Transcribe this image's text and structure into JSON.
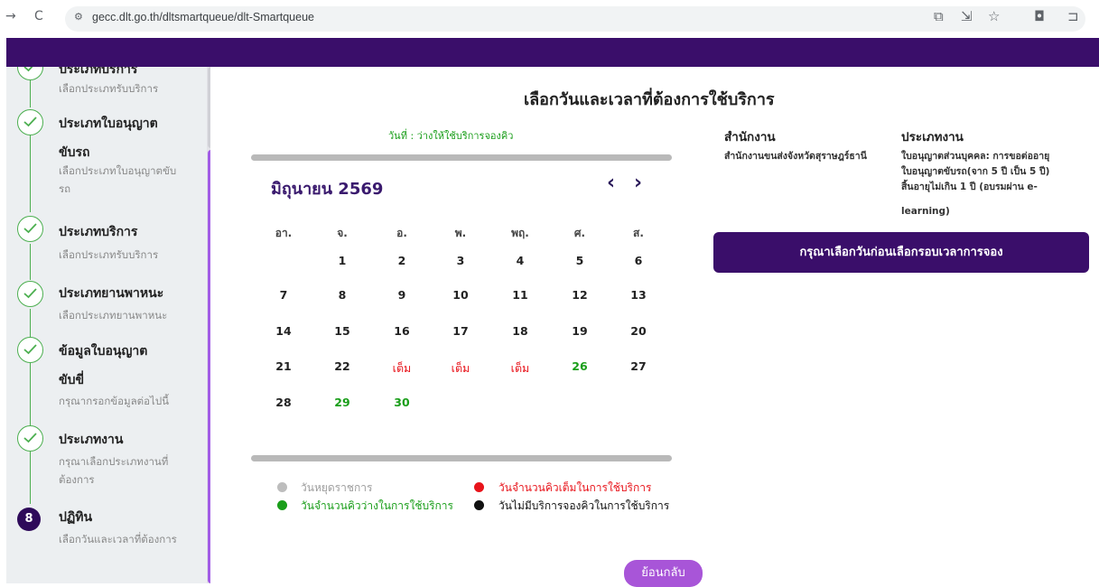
{
  "browser": {
    "url": "gecc.dlt.go.th/dltsmartqueue/dlt-Smartqueue",
    "back_icon": "→",
    "reload_icon": "C"
  },
  "sidebar": {
    "partial_top_title": "ประเภทบริการ",
    "steps": [
      {
        "sub": "เลือกประเภทรับบริการ"
      },
      {
        "title": "ประเภทใบอนุญาต",
        "title2": "ขับรถ",
        "sub": "เลือกประเภทใบอนุญาตขับ",
        "sub2": "รถ"
      },
      {
        "title": "ประเภทบริการ",
        "sub": "เลือกประเภทรับบริการ"
      },
      {
        "title": "ประเภทยานพาหนะ",
        "sub": "เลือกประเภทยานพาหนะ"
      },
      {
        "title": "ข้อมูลใบอนุญาต",
        "title2": "ขับขี่",
        "sub": "กรุณากรอกข้อมูลต่อไปนี้"
      },
      {
        "title": "ประเภทงาน",
        "sub": "กรุณาเลือกประเภทงานที่",
        "sub2": "ต้องการ"
      },
      {
        "num": "8",
        "title": "ปฏิทิน",
        "sub": "เลือกวันและเวลาที่ต้องการ"
      }
    ]
  },
  "main": {
    "title": "เลือกวันและเวลาที่ต้องการใช้บริการ",
    "date_hint": "วันที่ : ว่างให้ใช้บริการจองคิว",
    "month_label": "มิถุนายน 2569",
    "weekdays": [
      "อา.",
      "จ.",
      "อ.",
      "พ.",
      "พฤ.",
      "ศ.",
      "ส."
    ],
    "weeks": [
      [
        "",
        "1",
        "2",
        "3",
        "4",
        "5",
        "6"
      ],
      [
        "7",
        "8",
        "9",
        "10",
        "11",
        "12",
        "13"
      ],
      [
        "14",
        "15",
        "16",
        "17",
        "18",
        "19",
        "20"
      ],
      [
        "21",
        "22",
        "เต็ม",
        "เต็ม",
        "เต็ม",
        "26",
        "27"
      ],
      [
        "28",
        "29",
        "30",
        "",
        "",
        "",
        ""
      ]
    ],
    "legend": {
      "holiday": "วันหยุดราชการ",
      "full": "วันจำนวนคิวเต็มในการใช้บริการ",
      "available": "วันจำนวนคิวว่างในการใช้บริการ",
      "none": "วันไม่มีบริการจองคิวในการใช้บริการ"
    },
    "back_button": "ย้อนกลับ"
  },
  "info": {
    "office_label": "สำนักงาน",
    "office_value": "สำนักงานขนส่งจังหวัดสุราษฎร์ธานี",
    "job_label": "ประเภทงาน",
    "job_lines": [
      "ใบอนุญาตส่วนบุคคล: การขอต่ออายุ",
      "ใบอนุญาตขับรถ(จาก 5 ปี เป็น 5 ปี)",
      "สิ้นอายุไม่เกิน 1 ปี (อบรมผ่าน e-",
      "learning)"
    ],
    "slot_banner": "กรุณาเลือกวันก่อนเลือกรอบเวลาการจอง"
  },
  "colors": {
    "header": "#3a0e6a",
    "available": "#1a9e1a",
    "full": "#e8141b",
    "holiday": "#bdbdbd",
    "accent": "#a855d8"
  }
}
